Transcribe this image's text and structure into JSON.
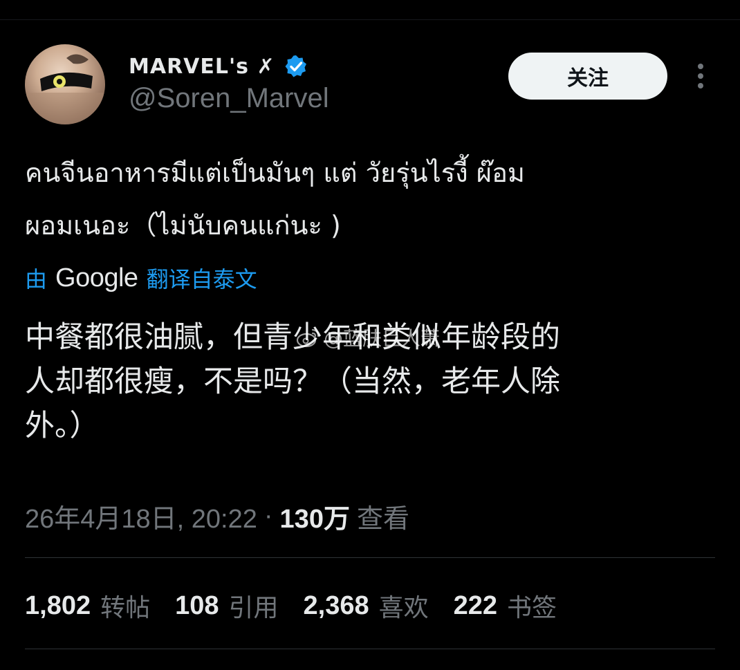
{
  "user": {
    "display_name": "MARVEL's",
    "display_name_suffix": "✗",
    "handle": "@Soren_Marvel",
    "verified": true
  },
  "header": {
    "follow_label": "关注"
  },
  "tweet": {
    "text_line1": "คนจีนอาหารมีแต่เป็นมันๆ แต่ วัยรุ่นไรงี้ ผ๊อม",
    "text_line2": "ผอมเนอะ（ไม่นับคนแก่นะ )"
  },
  "translation": {
    "prefix": "由",
    "provider": "Google",
    "suffix": "翻译自泰文",
    "line1": "中餐都很油腻，但青少年和类似年龄段的",
    "line2": "人却都很瘦，不是吗？（当然，老年人除",
    "line3": "外。）"
  },
  "watermark": {
    "text": "@蓝肤巨人萧"
  },
  "meta": {
    "datetime": "26年4月18日, 20:22",
    "separator": "·",
    "views_count": "130万",
    "views_label": "查看"
  },
  "stats": {
    "reposts_count": "1,802",
    "reposts_label": "转帖",
    "quotes_count": "108",
    "quotes_label": "引用",
    "likes_count": "2,368",
    "likes_label": "喜欢",
    "bookmarks_count": "222",
    "bookmarks_label": "书签"
  },
  "colors": {
    "background": "#000000",
    "text_primary": "#e7e9ea",
    "text_secondary": "#71767b",
    "accent_link": "#1d9bf0",
    "verified_badge": "#1d9bf0",
    "follow_button_bg": "#eff3f4"
  }
}
